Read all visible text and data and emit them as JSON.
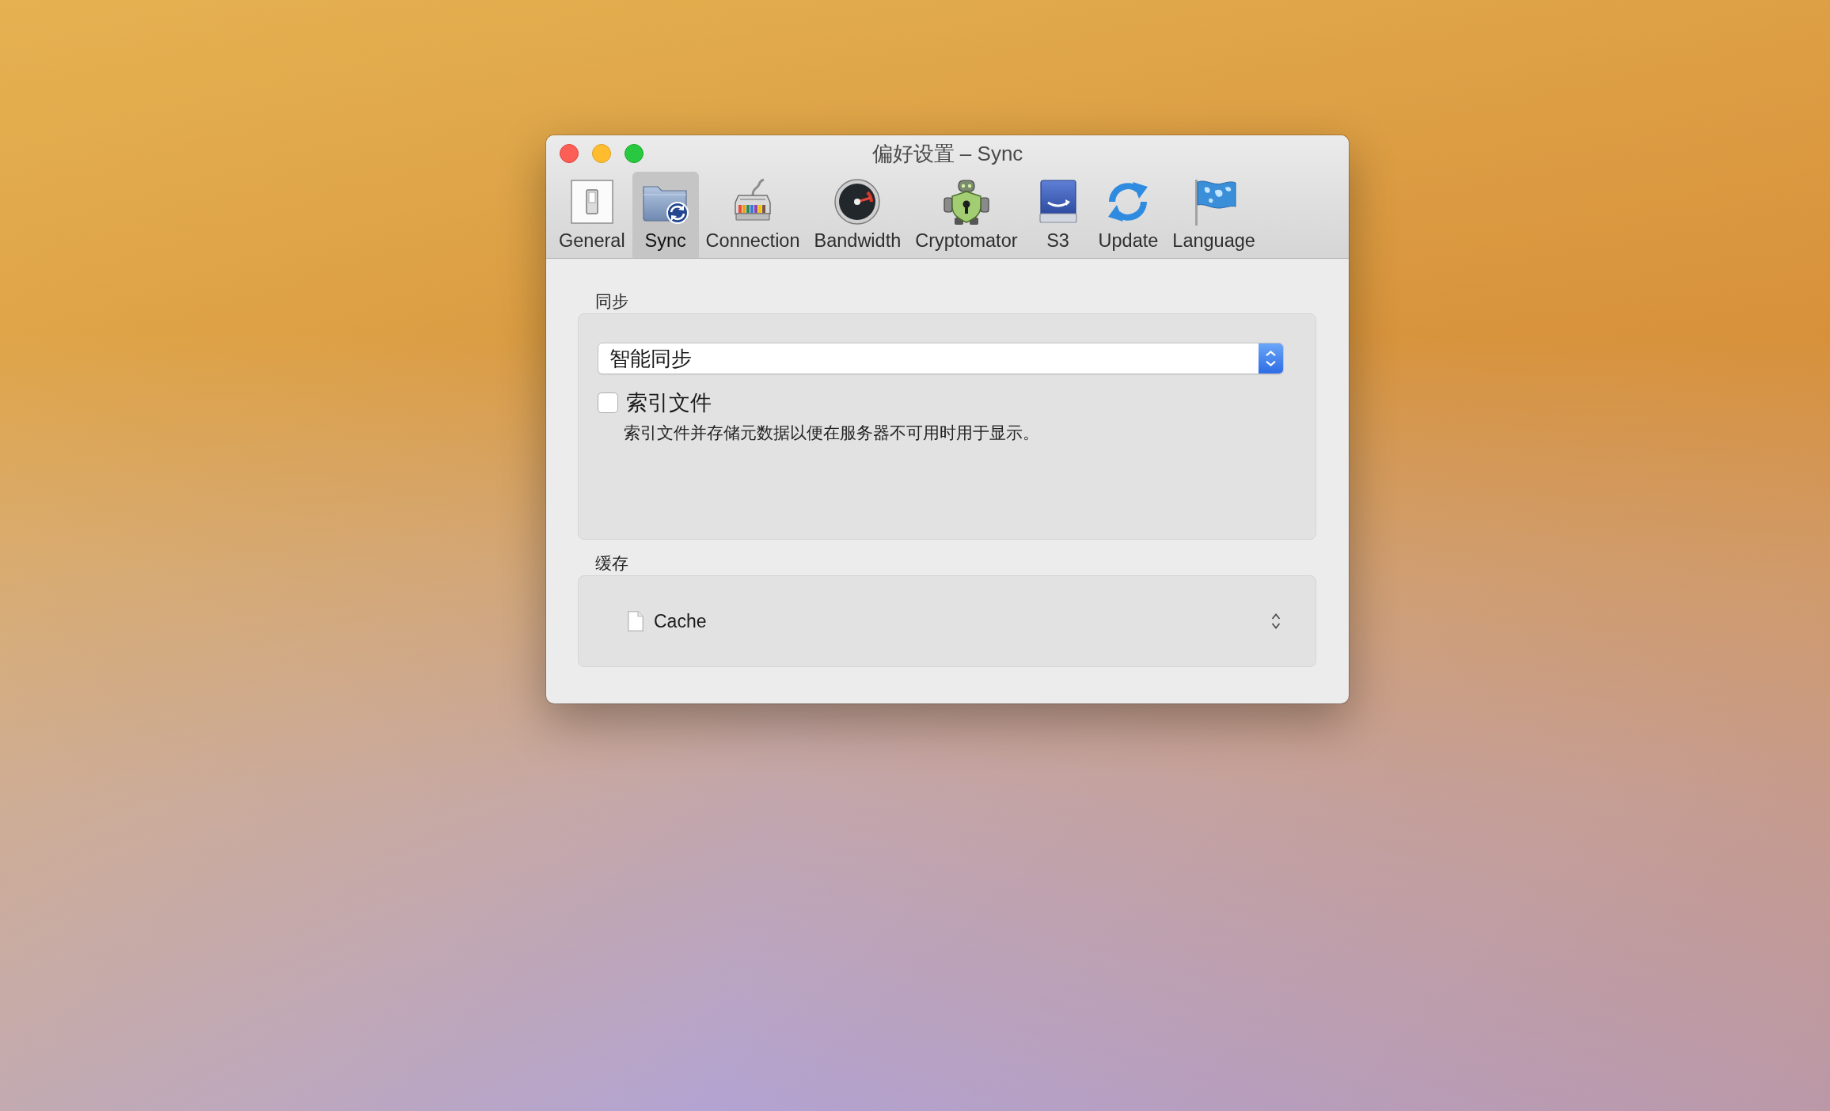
{
  "window": {
    "title": "偏好设置 – Sync"
  },
  "toolbar": {
    "tabs": [
      {
        "kind": "general",
        "label": "General",
        "selected": false
      },
      {
        "kind": "sync",
        "label": "Sync",
        "selected": true
      },
      {
        "kind": "connection",
        "label": "Connection",
        "selected": false
      },
      {
        "kind": "bandwidth",
        "label": "Bandwidth",
        "selected": false
      },
      {
        "kind": "cryptomator",
        "label": "Cryptomator",
        "selected": false
      },
      {
        "kind": "s3",
        "label": "S3",
        "selected": false
      },
      {
        "kind": "update",
        "label": "Update",
        "selected": false
      },
      {
        "kind": "language",
        "label": "Language",
        "selected": false
      }
    ]
  },
  "sync_group": {
    "heading": "同步",
    "popup": {
      "value": "智能同步"
    },
    "checkbox": {
      "label": "索引文件",
      "checked": false
    },
    "description": "索引文件并存储元数据以便在服务器不可用时用于显示。"
  },
  "cache_group": {
    "heading": "缓存",
    "popup": {
      "value": "Cache"
    }
  }
}
